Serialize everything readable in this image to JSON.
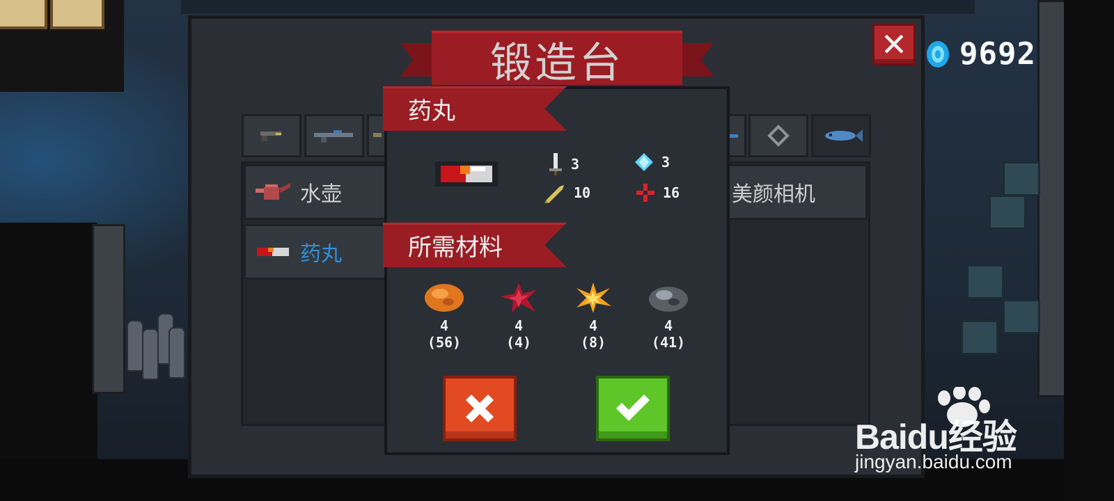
{
  "hud": {
    "gem_count": "9692",
    "gem_icon": "blue-gem-icon",
    "close_icon": "close-icon",
    "close_label": "✕"
  },
  "panel": {
    "title": "锻造台",
    "tabs": [
      {
        "icon": "pistol-icon"
      },
      {
        "icon": "rifle-icon"
      },
      {
        "icon": "gun-icon"
      },
      {
        "icon": "blaster-icon"
      },
      {
        "icon": "crosshair-icon"
      },
      {
        "icon": "fish-icon"
      }
    ],
    "items": [
      {
        "icon": "watering-can-icon",
        "label": "水壶"
      },
      {
        "icon": "pill-icon",
        "label": "药丸"
      },
      {
        "icon": "camera-icon",
        "label": "美颜相机"
      }
    ]
  },
  "modal": {
    "item_title": "药丸",
    "item_icon": "pill-icon",
    "stats": [
      {
        "icon": "sword-icon",
        "value": "3"
      },
      {
        "icon": "diamond-icon",
        "value": "3"
      },
      {
        "icon": "bullet-icon",
        "value": "10"
      },
      {
        "icon": "crosshair-icon",
        "value": "16"
      }
    ],
    "materials_title": "所需材料",
    "materials": [
      {
        "icon": "ore-icon",
        "required": "4",
        "owned": "(56)"
      },
      {
        "icon": "red-leaf-icon",
        "required": "4",
        "owned": "(4)"
      },
      {
        "icon": "spark-icon",
        "required": "4",
        "owned": "(8)"
      },
      {
        "icon": "iron-ore-icon",
        "required": "4",
        "owned": "(41)"
      }
    ],
    "cancel_icon": "cancel-icon",
    "confirm_icon": "checkmark-icon"
  },
  "watermark": {
    "brand": "Baidu经验",
    "url": "jingyan.baidu.com"
  }
}
